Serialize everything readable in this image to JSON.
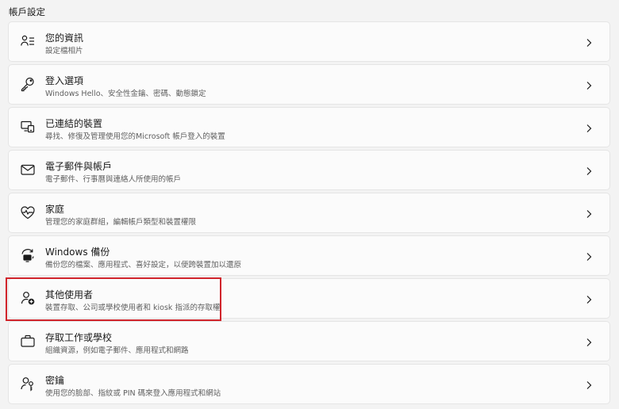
{
  "section_title": "帳戶設定",
  "accent_highlight": "#d0242b",
  "items": [
    {
      "title": "您的資訊",
      "desc": "設定檔相片",
      "icon": "person-info-icon"
    },
    {
      "title": "登入選項",
      "desc": "Windows Hello、安全性金鑰、密碼、動態鎖定",
      "icon": "key-icon"
    },
    {
      "title": "已連結的裝置",
      "desc": "尋找、修復及管理使用您的Microsoft 帳戶登入的裝置",
      "icon": "devices-icon"
    },
    {
      "title": "電子郵件與帳戶",
      "desc": "電子郵件、行事曆與連絡人所使用的帳戶",
      "icon": "mail-icon"
    },
    {
      "title": "家庭",
      "desc": "管理您的家庭群組，編輯帳戶類型和裝置權限",
      "icon": "family-heart-icon"
    },
    {
      "title": "Windows 備份",
      "desc": "備份您的檔案、應用程式、喜好設定，以便跨裝置加以還原",
      "icon": "backup-icon"
    },
    {
      "title": "其他使用者",
      "desc": "裝置存取、公司或學校使用者和 kiosk 指派的存取權",
      "icon": "add-person-icon"
    },
    {
      "title": "存取工作或學校",
      "desc": "組織資源，例如電子郵件、應用程式和網路",
      "icon": "briefcase-icon"
    },
    {
      "title": "密鑰",
      "desc": "使用您的臉部、指紋或 PIN 碼來登入應用程式和網站",
      "icon": "passkey-icon"
    }
  ]
}
